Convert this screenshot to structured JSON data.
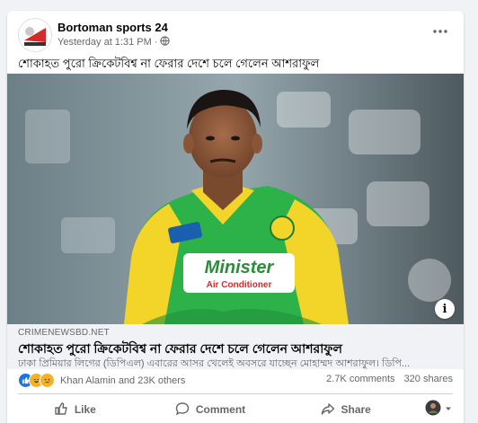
{
  "post": {
    "page_name": "Bortoman sports 24",
    "timestamp": "Yesterday at 1:31 PM",
    "separator": "·",
    "caption": "শোকাহত পুরো ক্রিকেটবিশ্ব না ফেরার দেশে চলে গেলেন আশরাফুল"
  },
  "jersey": {
    "sponsor_line1": "Minister",
    "sponsor_line2": "Air Conditioner"
  },
  "link": {
    "domain": "CRIMENEWSBD.NET",
    "title": "শোকাহত পুরো ক্রিকেটবিশ্ব না ফেরার দেশে চলে গেলেন আশরাফুল",
    "description": "ঢাকা প্রিমিয়ার লিগের (ডিপিএল) এবারের আসর খেলেই অবসরে যাচ্ছেন মোহাম্মদ আশরাফুল। ডিপি..."
  },
  "stats": {
    "reactors": "Khan Alamin and 23K others",
    "comments": "2.7K comments",
    "shares": "320 shares"
  },
  "actions": {
    "like": "Like",
    "comment": "Comment",
    "share": "Share"
  },
  "colors": {
    "jersey_green": "#2db24a",
    "jersey_yellow": "#f3d52a",
    "like_blue": "#1b74e4",
    "haha_yellow": "#f7b125",
    "sad_yellow": "#f7b125"
  }
}
